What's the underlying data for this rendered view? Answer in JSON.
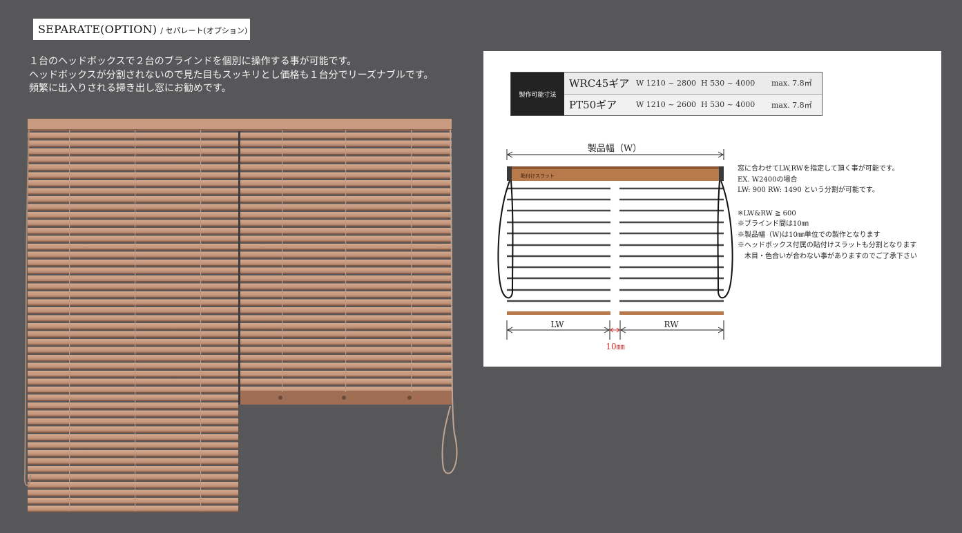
{
  "header": {
    "title": "SEPARATE(OPTION)",
    "subtitle": "/ セパレート(オプション)"
  },
  "description": [
    "１台のヘッドボックスで２台のブラインドを個別に操作する事が可能です。",
    "ヘッドボックスが分割されないので見た目もスッキリとし価格も１台分でリーズナブルです。",
    "頻繁に出入りされる掃き出し窓にお勧めです。"
  ],
  "spec": {
    "header": "製作可能寸法",
    "rows": [
      {
        "model": "WRC45ギア",
        "w": "W 1210 ~ 2800",
        "h": "H  530 ~ 4000",
        "max": "max. 7.8㎡"
      },
      {
        "model": "PT50ギア",
        "w": "W 1210 ~ 2600",
        "h": "H  530 ~ 4000",
        "max": "max. 7.8㎡"
      }
    ]
  },
  "diagram": {
    "width_label": "製品幅（W）",
    "headbox_label": "貼付けスラット",
    "lw_label": "LW",
    "rw_label": "RW",
    "gap_label": "10㎜"
  },
  "notes": {
    "lines": [
      "窓に合わせてLW,RWを指定して頂く事が可能です。",
      "EX. W2400の場合",
      "LW: 900 RW: 1490 という分割が可能です。"
    ],
    "remarks": [
      "※LW&RW ≧ 600",
      "※ブラインド間は10㎜",
      "※製品幅（W)は10㎜単位での製作となります",
      "※ヘッドボックス付属の貼付けスラットも分割となります",
      "　木目・色合いが合わない事がありますのでご了承下さい"
    ]
  },
  "colors": {
    "background": "#575759",
    "slat": "#c3957a",
    "headbox": "#b8784a",
    "dimension_red": "#d42b2b"
  }
}
